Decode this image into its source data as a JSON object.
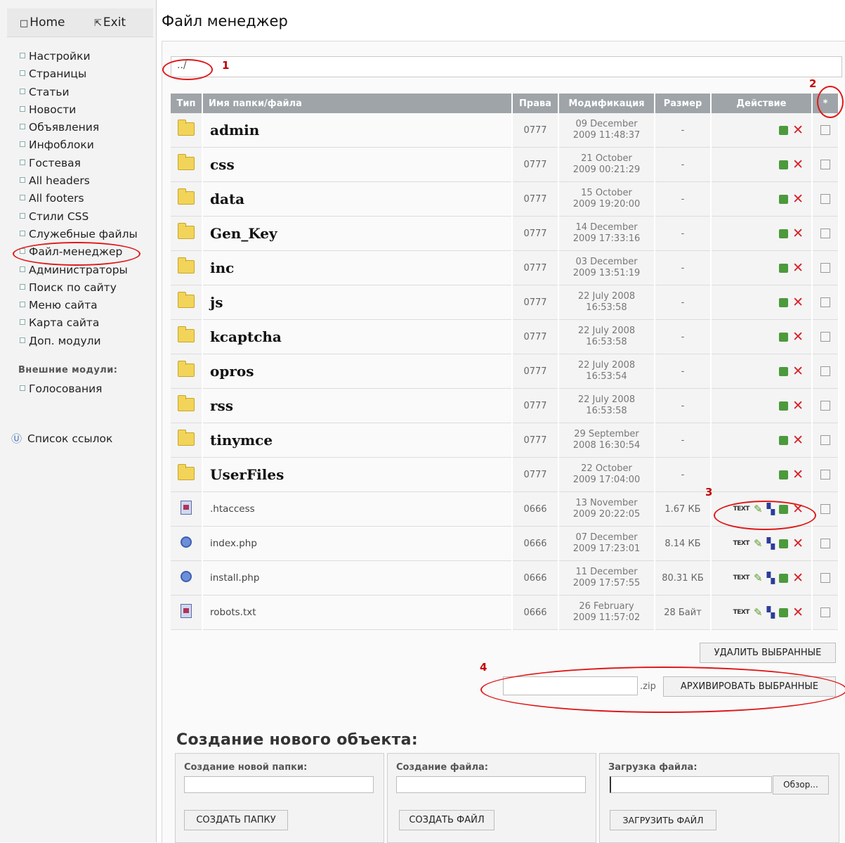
{
  "topnav": {
    "home_icon": "□",
    "home": "Home",
    "exit_icon": "⇱",
    "exit": "Exit"
  },
  "sidebar": {
    "items": [
      "Настройки",
      "Страницы",
      "Статьи",
      "Новости",
      "Объявления",
      "Инфоблоки",
      "Гостевая",
      "All headers",
      "All footers",
      "Стили CSS",
      "Служебные файлы",
      "Файл-менеджер",
      "Администраторы",
      "Поиск по сайту",
      "Меню сайта",
      "Карта сайта",
      "Доп. модули"
    ],
    "ext_title": "Внешние модули:",
    "ext_items": [
      "Голосования"
    ],
    "links_icon": "Ⓤ",
    "links": "Список ссылок"
  },
  "page_title": "Файл менеджер",
  "path": "../",
  "table": {
    "headers": {
      "type": "Тип",
      "name": "Имя папки/файла",
      "rights": "Права",
      "modified": "Модификация",
      "size": "Размер",
      "action": "Действие",
      "select": "*"
    },
    "rows": [
      {
        "kind": "dir",
        "name": "admin",
        "rights": "0777",
        "mod1": "09 December",
        "mod2": "2009 11:48:37",
        "size": "-"
      },
      {
        "kind": "dir",
        "name": "css",
        "rights": "0777",
        "mod1": "21 October",
        "mod2": "2009 00:21:29",
        "size": "-"
      },
      {
        "kind": "dir",
        "name": "data",
        "rights": "0777",
        "mod1": "15 October",
        "mod2": "2009 19:20:00",
        "size": "-"
      },
      {
        "kind": "dir",
        "name": "Gen_Key",
        "rights": "0777",
        "mod1": "14 December",
        "mod2": "2009 17:33:16",
        "size": "-"
      },
      {
        "kind": "dir",
        "name": "inc",
        "rights": "0777",
        "mod1": "03 December",
        "mod2": "2009 13:51:19",
        "size": "-"
      },
      {
        "kind": "dir",
        "name": "js",
        "rights": "0777",
        "mod1": "22 July 2008",
        "mod2": "16:53:58",
        "size": "-"
      },
      {
        "kind": "dir",
        "name": "kcaptcha",
        "rights": "0777",
        "mod1": "22 July 2008",
        "mod2": "16:53:58",
        "size": "-"
      },
      {
        "kind": "dir",
        "name": "opros",
        "rights": "0777",
        "mod1": "22 July 2008",
        "mod2": "16:53:54",
        "size": "-"
      },
      {
        "kind": "dir",
        "name": "rss",
        "rights": "0777",
        "mod1": "22 July 2008",
        "mod2": "16:53:58",
        "size": "-"
      },
      {
        "kind": "dir",
        "name": "tinymce",
        "rights": "0777",
        "mod1": "29 September",
        "mod2": "2008 16:30:54",
        "size": "-"
      },
      {
        "kind": "dir",
        "name": "UserFiles",
        "rights": "0777",
        "mod1": "22 October",
        "mod2": "2009 17:04:00",
        "size": "-"
      },
      {
        "kind": "file",
        "icon": "file-icon",
        "name": ".htaccess",
        "rights": "0666",
        "mod1": "13 November",
        "mod2": "2009 20:22:05",
        "size": "1.67 КБ"
      },
      {
        "kind": "file",
        "icon": "php-icon",
        "name": "index.php",
        "rights": "0666",
        "mod1": "07 December",
        "mod2": "2009 17:23:01",
        "size": "8.14 КБ"
      },
      {
        "kind": "file",
        "icon": "php-icon",
        "name": "install.php",
        "rights": "0666",
        "mod1": "11 December",
        "mod2": "2009 17:57:55",
        "size": "80.31 КБ"
      },
      {
        "kind": "file",
        "icon": "file-icon",
        "name": "robots.txt",
        "rights": "0666",
        "mod1": "26 February",
        "mod2": "2009 11:57:02",
        "size": "28 Байт"
      }
    ],
    "action_icons": {
      "text": "TEXT",
      "edit": "✎",
      "save": "▚",
      "delete": "✕"
    }
  },
  "buttons": {
    "delete_selected": "УДАЛИТЬ ВЫБРАННЫЕ",
    "archive_selected": "АРХИВИРОВАТЬ ВЫБРАННЫЕ",
    "zip_suffix": ".zip"
  },
  "create": {
    "title": "Создание нового объекта:",
    "folder_label": "Создание новой папки:",
    "folder_button": "СОЗДАТЬ ПАПКУ",
    "file_label": "Создание файла:",
    "file_button": "СОЗДАТЬ ФАЙЛ",
    "upload_label": "Загрузка файла:",
    "browse_button": "Обзор...",
    "upload_button": "ЗАГРУЗИТЬ ФАЙЛ"
  },
  "annotations": [
    "1",
    "2",
    "3",
    "4"
  ],
  "colors": {
    "header_bg": "#9fa4a8",
    "delete_red": "#d8202a",
    "annotation_red": "#e01818"
  }
}
